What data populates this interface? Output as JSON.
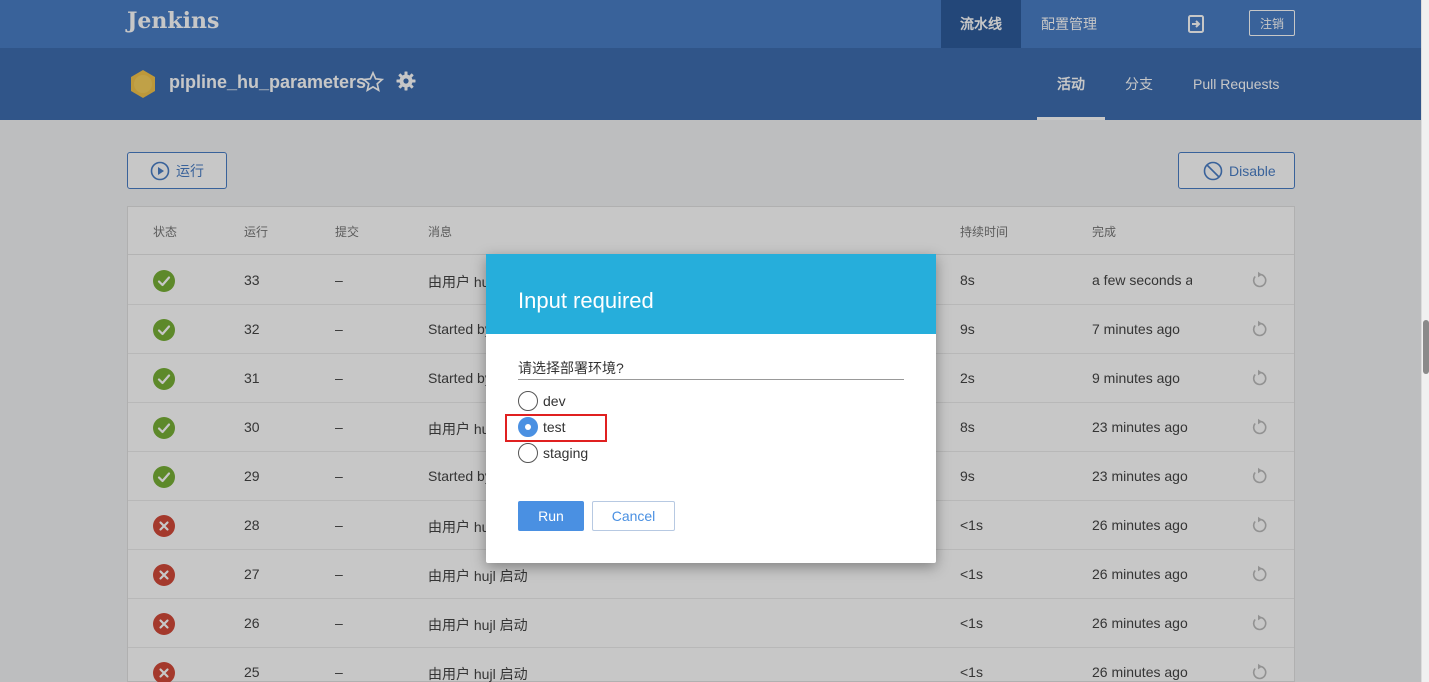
{
  "topbar": {
    "brand": "Jenkins",
    "nav_pipeline": "流水线",
    "nav_admin": "配置管理",
    "logout_label": "注销"
  },
  "pipeline": {
    "name": "pipline_hu_parameters",
    "tabs": [
      {
        "label": "活动",
        "active": true
      },
      {
        "label": "分支",
        "active": false
      },
      {
        "label": "Pull Requests",
        "active": false
      }
    ]
  },
  "actions": {
    "run_label": "运行",
    "disable_label": "Disable"
  },
  "table": {
    "headers": [
      "状态",
      "运行",
      "提交",
      "消息",
      "持续时间",
      "完成"
    ],
    "rows": [
      {
        "status": "success",
        "run": "33",
        "commit": "–",
        "message": "由用户 hu",
        "duration": "8s",
        "completed": "a few seconds ag"
      },
      {
        "status": "success",
        "run": "32",
        "commit": "–",
        "message": "Started by",
        "duration": "9s",
        "completed": "7 minutes ago"
      },
      {
        "status": "success",
        "run": "31",
        "commit": "–",
        "message": "Started by",
        "duration": "2s",
        "completed": "9 minutes ago"
      },
      {
        "status": "success",
        "run": "30",
        "commit": "–",
        "message": "由用户 hu",
        "duration": "8s",
        "completed": "23 minutes ago"
      },
      {
        "status": "success",
        "run": "29",
        "commit": "–",
        "message": "Started by",
        "duration": "9s",
        "completed": "23 minutes ago"
      },
      {
        "status": "failure",
        "run": "28",
        "commit": "–",
        "message": "由用户 hu",
        "duration": "<1s",
        "completed": "26 minutes ago"
      },
      {
        "status": "failure",
        "run": "27",
        "commit": "–",
        "message": "由用户 hujl 启动",
        "duration": "<1s",
        "completed": "26 minutes ago"
      },
      {
        "status": "failure",
        "run": "26",
        "commit": "–",
        "message": "由用户 hujl 启动",
        "duration": "<1s",
        "completed": "26 minutes ago"
      },
      {
        "status": "failure",
        "run": "25",
        "commit": "–",
        "message": "由用户 hujl 启动",
        "duration": "<1s",
        "completed": "26 minutes ago"
      }
    ]
  },
  "dialog": {
    "title": "Input required",
    "question": "请选择部署环境?",
    "options": [
      {
        "label": "dev",
        "checked": false
      },
      {
        "label": "test",
        "checked": true
      },
      {
        "label": "staging",
        "checked": false
      }
    ],
    "run_label": "Run",
    "cancel_label": "Cancel"
  },
  "colors": {
    "topbar": "#4a7ec6",
    "subbar": "#3e6eb0",
    "dialog_header": "#26aedb",
    "success": "#78b037",
    "failure": "#d24939",
    "highlight": "#e02020"
  }
}
